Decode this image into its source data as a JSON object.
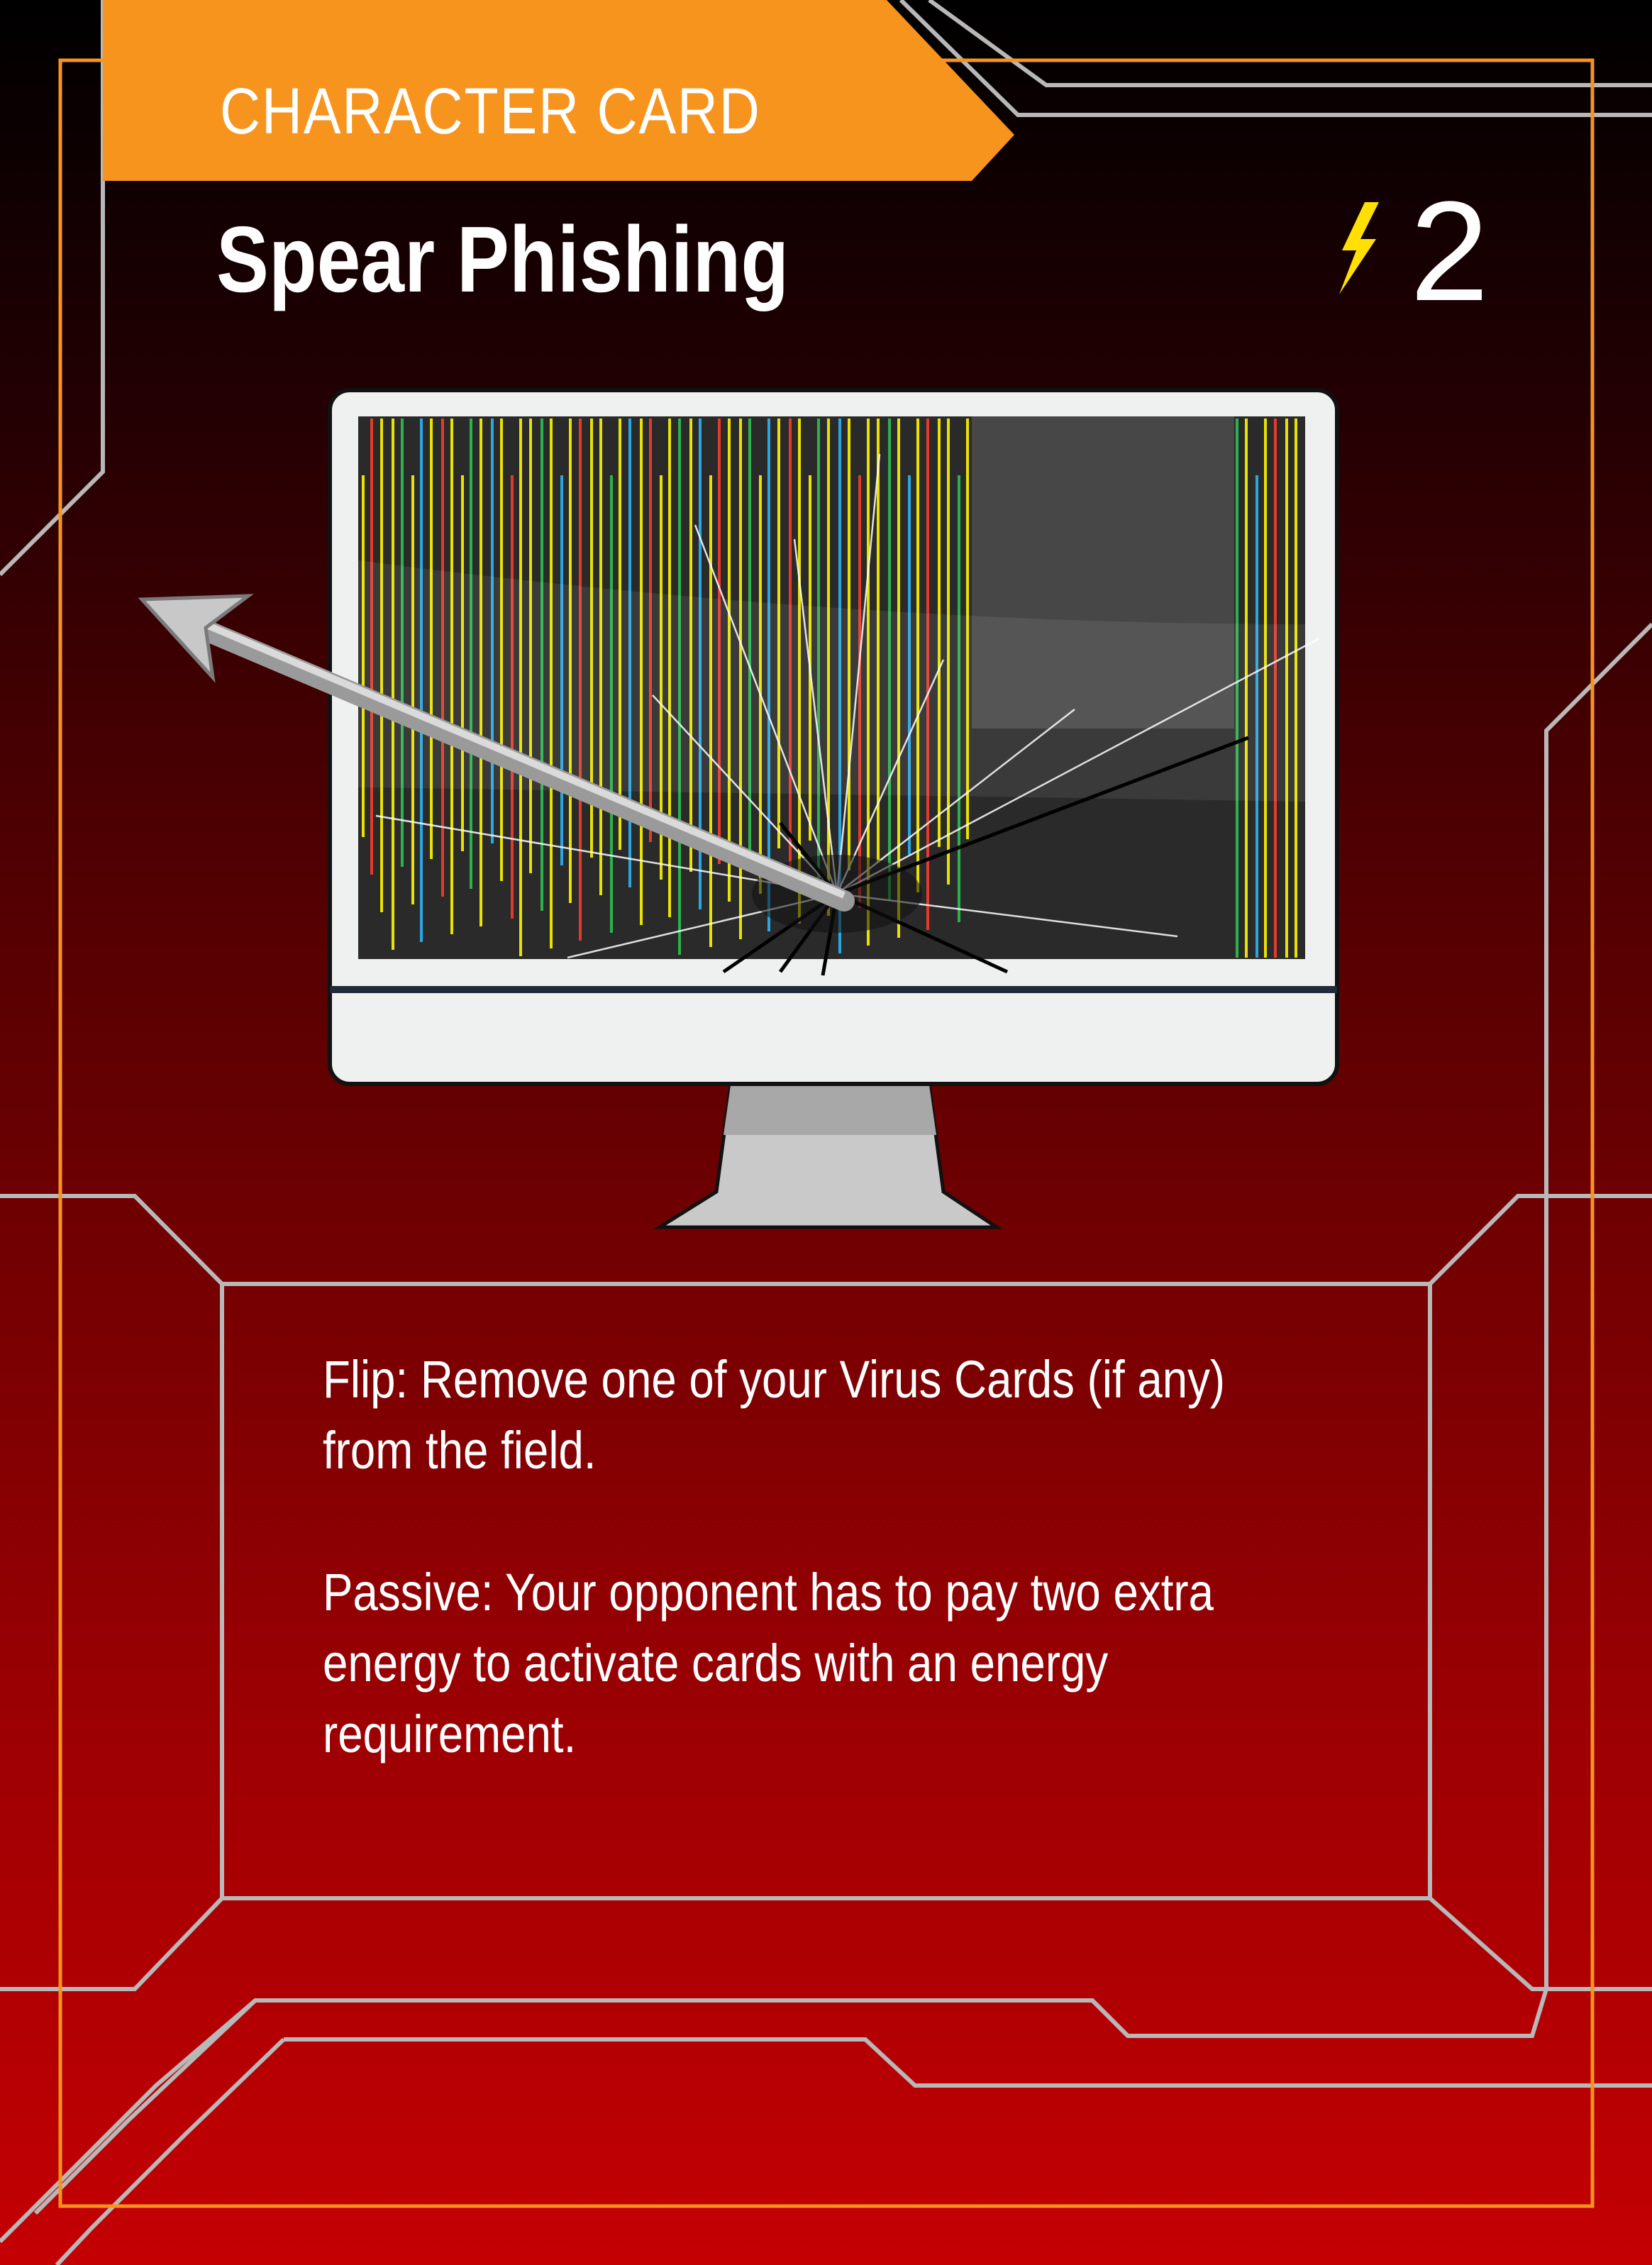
{
  "card": {
    "type_label": "CHARACTER CARD",
    "title": "Spear Phishing",
    "energy_cost": "2",
    "energy_icon": "lightning-bolt-icon",
    "abilities": [
      "Flip: Remove one of your Virus Cards (if any) from the field.",
      "Passive: Your opponent has to pay two extra energy to activate cards with an energy requirement."
    ]
  },
  "colors": {
    "banner": "#f7941d",
    "frame": "#f7941d",
    "circuit_lines": "#b8b8b8",
    "energy_bolt": "#ffe000",
    "background_top": "#000000",
    "background_bottom": "#c40003"
  },
  "illustration": {
    "subject": "cracked computer monitor pierced by a spear"
  }
}
